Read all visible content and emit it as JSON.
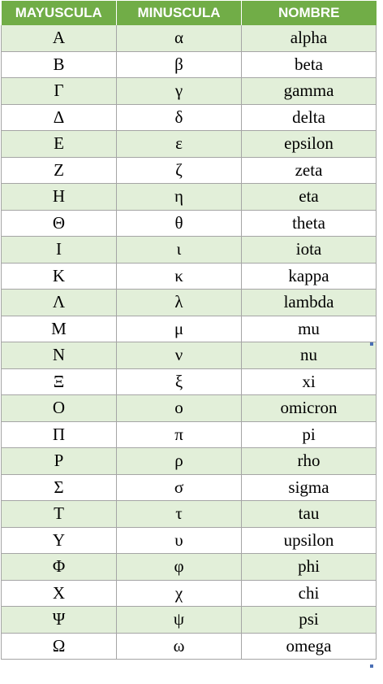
{
  "table": {
    "headers": [
      "MAYUSCULA",
      "MINUSCULA",
      "NOMBRE"
    ],
    "rows": [
      [
        "Α",
        "α",
        "alpha"
      ],
      [
        "Β",
        "β",
        "beta"
      ],
      [
        "Γ",
        "γ",
        "gamma"
      ],
      [
        "Δ",
        "δ",
        "delta"
      ],
      [
        "Ε",
        "ε",
        "epsilon"
      ],
      [
        "Ζ",
        "ζ",
        "zeta"
      ],
      [
        "Η",
        "η",
        "eta"
      ],
      [
        "Θ",
        "θ",
        "theta"
      ],
      [
        "Ι",
        "ι",
        "iota"
      ],
      [
        "Κ",
        "κ",
        "kappa"
      ],
      [
        "Λ",
        "λ",
        "lambda"
      ],
      [
        "Μ",
        "μ",
        "mu"
      ],
      [
        "Ν",
        "ν",
        "nu"
      ],
      [
        "Ξ",
        "ξ",
        "xi"
      ],
      [
        "Ο",
        "ο",
        "omicron"
      ],
      [
        "Π",
        "π",
        "pi"
      ],
      [
        "Ρ",
        "ρ",
        "rho"
      ],
      [
        "Σ",
        "σ",
        "sigma"
      ],
      [
        "Τ",
        "τ",
        "tau"
      ],
      [
        "Υ",
        "υ",
        "upsilon"
      ],
      [
        "Φ",
        "φ",
        "phi"
      ],
      [
        "Χ",
        "χ",
        "chi"
      ],
      [
        "Ψ",
        "ψ",
        "psi"
      ],
      [
        "Ω",
        "ω",
        "omega"
      ]
    ]
  },
  "colors": {
    "header_bg": "#71ad47",
    "header_text": "#ffffff",
    "band_fill": "#e2efd9",
    "grid_line": "#a5a5a5"
  }
}
